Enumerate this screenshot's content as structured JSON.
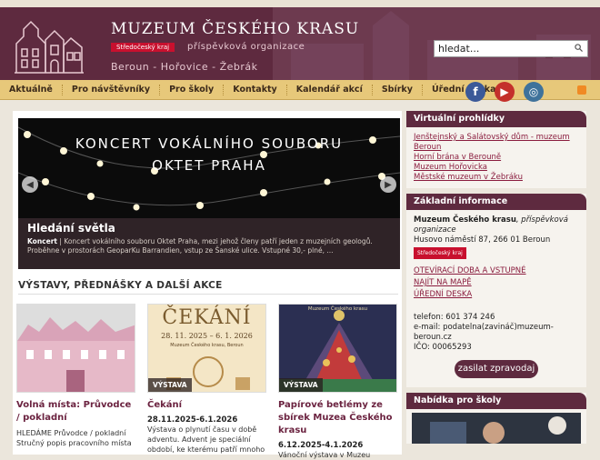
{
  "header": {
    "title": "MUZEUM ČESKÉHO KRASU",
    "badge": "Středočeský kraj",
    "subtitle": "příspěvková organizace",
    "places": "Beroun - Hořovice - Žebrák",
    "search_value": "hledat..."
  },
  "nav": {
    "items": [
      "Aktuálně",
      "Pro návštěvníky",
      "Pro školy",
      "Kontakty",
      "Kalendář akcí",
      "Sbírky",
      "Úřední deska"
    ]
  },
  "social": {
    "fb": "f",
    "yt": "▶",
    "ig": "◎"
  },
  "slider": {
    "title_line1": "KONCERT VOKÁLNÍHO SOUBORU",
    "title_line2": "OKTET PRAHA",
    "caption_title": "Hledání světla",
    "caption_lead": "Koncert",
    "caption_text": " | Koncert vokálního souboru Oktet Praha, mezi jehož členy patří jeden z muzejních geologů. Proběhne v prostorách GeoparKu Barrandien, vstup ze Šanské ulice. Vstupné 30,- plné, ..."
  },
  "events": {
    "heading": "VÝSTAVY, PŘEDNÁŠKY A DALŠÍ AKCE",
    "cards": [
      {
        "title": "Volná místa: Průvodce / pokladní",
        "tag": "",
        "date": "",
        "text": "HLEDÁME Průvodce / pokladní Stručný popis pracovního místa"
      },
      {
        "title": "Čekání",
        "tag": "VÝSTAVA",
        "date": "28.11.2025-6.1.2026",
        "text": "Výstava o plynutí času v době adventu. Advent je speciální období, ke kterému patří mnoho"
      },
      {
        "title": "Papírové betlémy ze sbírek Muzea Českého krasu",
        "tag": "VÝSTAVA",
        "date": "6.12.2025-4.1.2026",
        "text": "Vánoční výstava v Muzeu"
      }
    ]
  },
  "poster": {
    "big": "ČEKÁNÍ",
    "dates": "28. 11. 2025 – 6. 1. 2026",
    "small": "Muzeum Českého krasu, Beroun",
    "betlem_head": "Muzeum Českého krasu"
  },
  "sidebar": {
    "virtual": {
      "heading": "Virtuální prohlídky",
      "links": [
        "Jenštejnský a Salátovský dům - muzeum Beroun",
        "Horní brána v Berouně",
        "Muzeum Hořovicka",
        "Městské muzeum v Žebráku"
      ]
    },
    "info": {
      "heading": "Základní informace",
      "org_name": "Muzeum Českého krasu",
      "org_type": ", příspěvková organizace",
      "address": "Husovo náměstí 87, 266 01 Beroun",
      "badge": "Středočeský kraj",
      "links": [
        "OTEVÍRACÍ DOBA A VSTUPNÉ",
        "NAJÍT NA MAPĚ",
        "ÚŘEDNÍ DESKA"
      ],
      "phone": "telefon: 601 374 246",
      "email": "e-mail: podatelna(zavináč)muzeum-beroun.cz",
      "ico": "IČO: 00065293",
      "newsletter": "zasilat zpravodaj"
    },
    "schools": {
      "heading": "Nabídka pro školy"
    }
  }
}
